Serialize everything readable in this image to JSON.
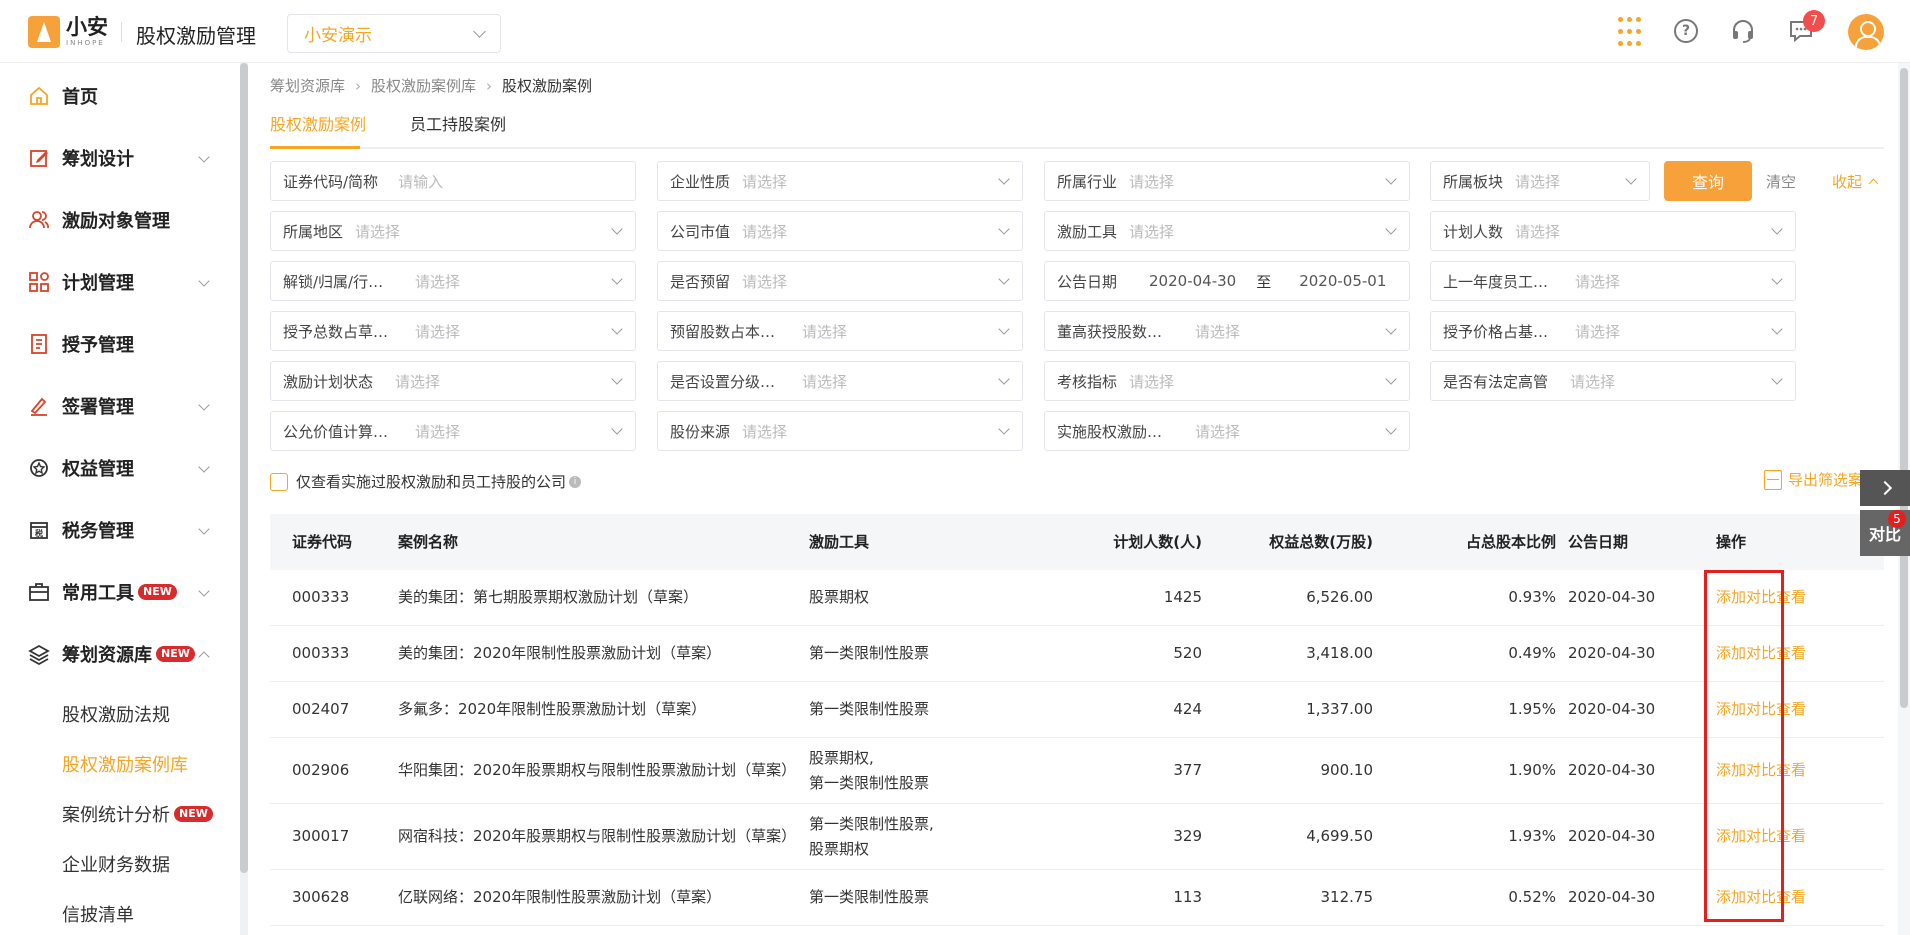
{
  "header": {
    "logo_cn": "小安",
    "logo_en": "INHOPE",
    "app_title": "股权激励管理",
    "company": "小安演示",
    "message_count": "7"
  },
  "sidebar": {
    "items": [
      {
        "label": "首页",
        "icon": "home-icon"
      },
      {
        "label": "筹划设计",
        "icon": "edit-icon"
      },
      {
        "label": "激励对象管理",
        "icon": "users-icon"
      },
      {
        "label": "计划管理",
        "icon": "plan-icon"
      },
      {
        "label": "授予管理",
        "icon": "grant-icon"
      },
      {
        "label": "签署管理",
        "icon": "sign-icon"
      },
      {
        "label": "权益管理",
        "icon": "equity-icon"
      },
      {
        "label": "税务管理",
        "icon": "tax-icon"
      },
      {
        "label": "常用工具",
        "icon": "toolbox-icon",
        "badge": "NEW"
      },
      {
        "label": "筹划资源库",
        "icon": "layers-icon",
        "badge": "NEW"
      }
    ],
    "sub_items": [
      {
        "label": "股权激励法规"
      },
      {
        "label": "股权激励案例库"
      },
      {
        "label": "案例统计分析",
        "badge": "NEW"
      },
      {
        "label": "企业财务数据"
      },
      {
        "label": "信披清单"
      }
    ]
  },
  "breadcrumb": [
    "筹划资源库",
    "股权激励案例库",
    "股权激励案例"
  ],
  "tabs": [
    "股权激励案例",
    "员工持股案例"
  ],
  "filters": [
    {
      "label": "证券代码/简称",
      "placeholder": "请输入"
    },
    {
      "label": "企业性质",
      "placeholder": "请选择"
    },
    {
      "label": "所属行业",
      "placeholder": "请选择"
    },
    {
      "label": "所属板块",
      "placeholder": "请选择"
    },
    {
      "label": "所属地区",
      "placeholder": "请选择"
    },
    {
      "label": "公司市值",
      "placeholder": "请选择"
    },
    {
      "label": "激励工具",
      "placeholder": "请选择"
    },
    {
      "label": "计划人数",
      "placeholder": "请选择"
    },
    {
      "label": "解锁/归属/行…",
      "placeholder": "请选择"
    },
    {
      "label": "是否预留",
      "placeholder": "请选择"
    },
    {
      "label": "公告日期",
      "date_from": "2020-04-30",
      "to": "至",
      "date_to": "2020-05-01"
    },
    {
      "label": "上一年度员工…",
      "placeholder": "请选择"
    },
    {
      "label": "授予总数占草…",
      "placeholder": "请选择"
    },
    {
      "label": "预留股数占本…",
      "placeholder": "请选择"
    },
    {
      "label": "董高获授股数…",
      "placeholder": "请选择"
    },
    {
      "label": "授予价格占基…",
      "placeholder": "请选择"
    },
    {
      "label": "激励计划状态",
      "placeholder": "请选择"
    },
    {
      "label": "是否设置分级…",
      "placeholder": "请选择"
    },
    {
      "label": "考核指标",
      "placeholder": "请选择"
    },
    {
      "label": "是否有法定高管",
      "placeholder": "请选择"
    },
    {
      "label": "公允价值计算…",
      "placeholder": "请选择"
    },
    {
      "label": "股份来源",
      "placeholder": "请选择"
    },
    {
      "label": "实施股权激励…",
      "placeholder": "请选择"
    }
  ],
  "actions": {
    "query": "查询",
    "clear": "清空",
    "collapse": "收起"
  },
  "only_checkbox_label": "仅查看实施过股权激励和员工持股的公司",
  "export_label": "导出筛选案例",
  "table": {
    "headers": [
      "证券代码",
      "案例名称",
      "激励工具",
      "计划人数(人)",
      "权益总数(万股)",
      "占总股本比例",
      "公告日期",
      "操作"
    ],
    "rows": [
      {
        "code": "000333",
        "name": "美的集团：第七期股票期权激励计划（草案）",
        "tool1": "股票期权",
        "tool2": "",
        "count": "1425",
        "equity": "6,526.00",
        "pct": "0.93%",
        "date": "2020-04-30"
      },
      {
        "code": "000333",
        "name": "美的集团：2020年限制性股票激励计划（草案）",
        "tool1": "第一类限制性股票",
        "tool2": "",
        "count": "520",
        "equity": "3,418.00",
        "pct": "0.49%",
        "date": "2020-04-30"
      },
      {
        "code": "002407",
        "name": "多氟多：2020年限制性股票激励计划（草案）",
        "tool1": "第一类限制性股票",
        "tool2": "",
        "count": "424",
        "equity": "1,337.00",
        "pct": "1.95%",
        "date": "2020-04-30"
      },
      {
        "code": "002906",
        "name": "华阳集团：2020年股票期权与限制性股票激励计划（草案）",
        "tool1": "股票期权,",
        "tool2": "第一类限制性股票",
        "count": "377",
        "equity": "900.10",
        "pct": "1.90%",
        "date": "2020-04-30"
      },
      {
        "code": "300017",
        "name": "网宿科技：2020年股票期权与限制性股票激励计划（草案）",
        "tool1": "第一类限制性股票,",
        "tool2": "股票期权",
        "count": "329",
        "equity": "4,699.50",
        "pct": "1.93%",
        "date": "2020-04-30"
      },
      {
        "code": "300628",
        "name": "亿联网络：2020年限制性股票激励计划（草案）",
        "tool1": "第一类限制性股票",
        "tool2": "",
        "count": "113",
        "equity": "312.75",
        "pct": "0.52%",
        "date": "2020-04-30"
      }
    ],
    "op_add": "添加对比",
    "op_view": "查看"
  },
  "float": {
    "compare_label": "对比",
    "compare_count": "5"
  },
  "colors": {
    "accent": "#f5a623",
    "highlight": "#e51e1e"
  }
}
